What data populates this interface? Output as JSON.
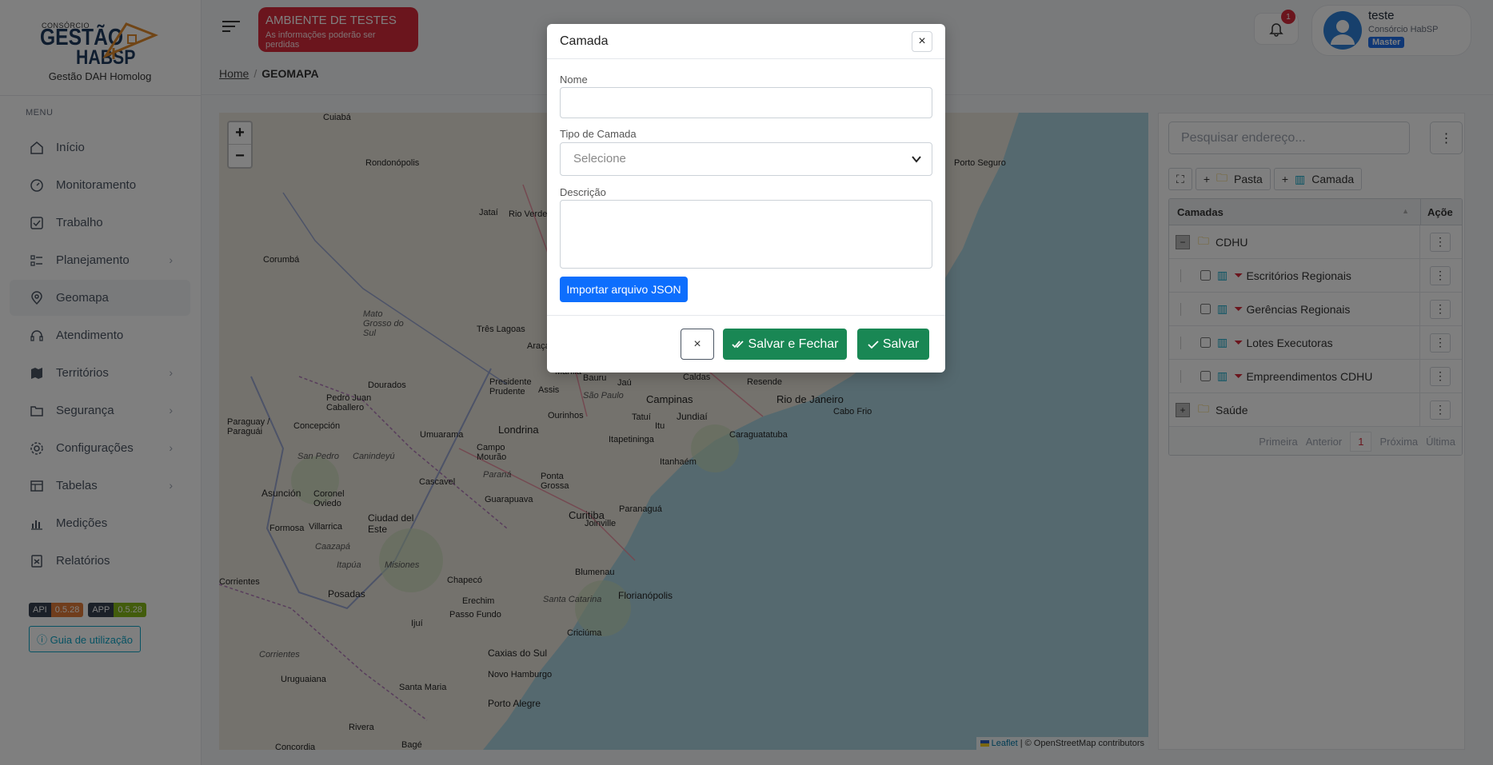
{
  "logo": {
    "small": "CONSÓRCIO",
    "big1": "GESTÃO",
    "big2": "HABSP",
    "subtitle": "Gestão DAH Homolog"
  },
  "menu": {
    "title": "MENU",
    "items": [
      {
        "label": "Início",
        "icon": "home-icon",
        "has_sub": false,
        "active": false
      },
      {
        "label": "Monitoramento",
        "icon": "gauge-icon",
        "has_sub": false,
        "active": false
      },
      {
        "label": "Trabalho",
        "icon": "checkbox-icon",
        "has_sub": false,
        "active": false
      },
      {
        "label": "Planejamento",
        "icon": "list-check-icon",
        "has_sub": true,
        "active": false
      },
      {
        "label": "Geomapa",
        "icon": "map-pin-icon",
        "has_sub": false,
        "active": true
      },
      {
        "label": "Atendimento",
        "icon": "headset-icon",
        "has_sub": false,
        "active": false
      },
      {
        "label": "Territórios",
        "icon": "map-icon",
        "has_sub": true,
        "active": false
      },
      {
        "label": "Segurança",
        "icon": "shield-folder-icon",
        "has_sub": true,
        "active": false
      },
      {
        "label": "Configurações",
        "icon": "gear-icon",
        "has_sub": true,
        "active": false
      },
      {
        "label": "Tabelas",
        "icon": "table-icon",
        "has_sub": true,
        "active": false
      },
      {
        "label": "Medições",
        "icon": "bar-chart-icon",
        "has_sub": false,
        "active": false
      },
      {
        "label": "Relatórios",
        "icon": "report-icon",
        "has_sub": false,
        "active": false
      }
    ]
  },
  "versions": {
    "api_key": "API",
    "api_val": "0.5.28",
    "app_key": "APP",
    "app_val": "0.5.28"
  },
  "guide_label": "Guia de utilização",
  "env": {
    "title": "AMBIENTE DE TESTES",
    "subtitle": "As informações poderão ser perdidas"
  },
  "breadcrumb": {
    "home": "Home",
    "current": "GEOMAPA"
  },
  "notifications": {
    "count": "1"
  },
  "user": {
    "name": "teste",
    "org": "Consórcio HabSP",
    "role": "Master"
  },
  "map": {
    "zoom_in": "+",
    "zoom_out": "−",
    "labels": [
      "Cuiabá",
      "Rondonópolis",
      "Jataí",
      "Rio Verde",
      "Corumbá",
      "Mato Grosso do Sul",
      "Três Lagoas",
      "Araçatuba",
      "Presidente Prudente",
      "Assis",
      "Marília",
      "Bauru",
      "Jaú",
      "São Paulo",
      "Caldas",
      "Resende",
      "Rio de Janeiro",
      "Cabo Frio",
      "Campinas",
      "Jundiaí",
      "Itu",
      "Tatuí",
      "Itapetininga",
      "Caraguatatuba",
      "Itanhaém",
      "Ourinhos",
      "Londrina",
      "Umuarama",
      "Dourados",
      "Pedro Juan Caballero",
      "Concepción",
      "Paraguay / Paraguái",
      "Campo Mourão",
      "Paraná",
      "Ponta Grossa",
      "Guarapuava",
      "Cascavel",
      "Curitiba",
      "Paranaguá",
      "Joinville",
      "Blumenau",
      "Florianópolis",
      "Santa Catarina",
      "Chapecó",
      "Erechim",
      "Passo Fundo",
      "Caxias do Sul",
      "Criciúma",
      "Novo Hamburgo",
      "Porto Alegre",
      "Santa Maria",
      "Uruguaiana",
      "Posadas",
      "Ciudad del Este",
      "Asunción",
      "Coronel Oviedo",
      "Villarrica",
      "Formosa",
      "Corrientes",
      "Rivera",
      "Bagé",
      "Concordia",
      "Porto Seguro",
      "Pasta",
      "Ijuí",
      "Misiones",
      "Itapúa",
      "San Pedro",
      "Canindeyú",
      "Caazapá",
      "Corrientes"
    ],
    "attribution_link": "Leaflet",
    "attribution_text": " | © OpenStreetMap contributors"
  },
  "panel": {
    "search_placeholder": "Pesquisar endereço...",
    "btn_folder": "Pasta",
    "btn_layer": "Camada",
    "col_layers": "Camadas",
    "col_actions": "Açõe",
    "tree": [
      {
        "type": "folder",
        "label": "CDHU",
        "toggle": "−"
      },
      {
        "type": "layer",
        "label": "Escritórios Regionais"
      },
      {
        "type": "layer",
        "label": "Gerências Regionais"
      },
      {
        "type": "layer",
        "label": "Lotes Executoras"
      },
      {
        "type": "layer",
        "label": "Empreendimentos CDHU"
      },
      {
        "type": "folder",
        "label": "Saúde",
        "toggle": "+"
      }
    ],
    "pager": {
      "first": "Primeira",
      "prev": "Anterior",
      "page": "1",
      "next": "Próxima",
      "last": "Última"
    }
  },
  "modal": {
    "title": "Camada",
    "name_label": "Nome",
    "name_value": "",
    "type_label": "Tipo de Camada",
    "type_placeholder": "Selecione",
    "desc_label": "Descrição",
    "desc_value": "",
    "import_label": "Importar arquivo JSON",
    "save_close_label": "Salvar e Fechar",
    "save_label": "Salvar"
  },
  "colors": {
    "danger": "#d62a3a",
    "success": "#198754",
    "primary": "#0d6efd",
    "info": "#0ea5c6"
  }
}
